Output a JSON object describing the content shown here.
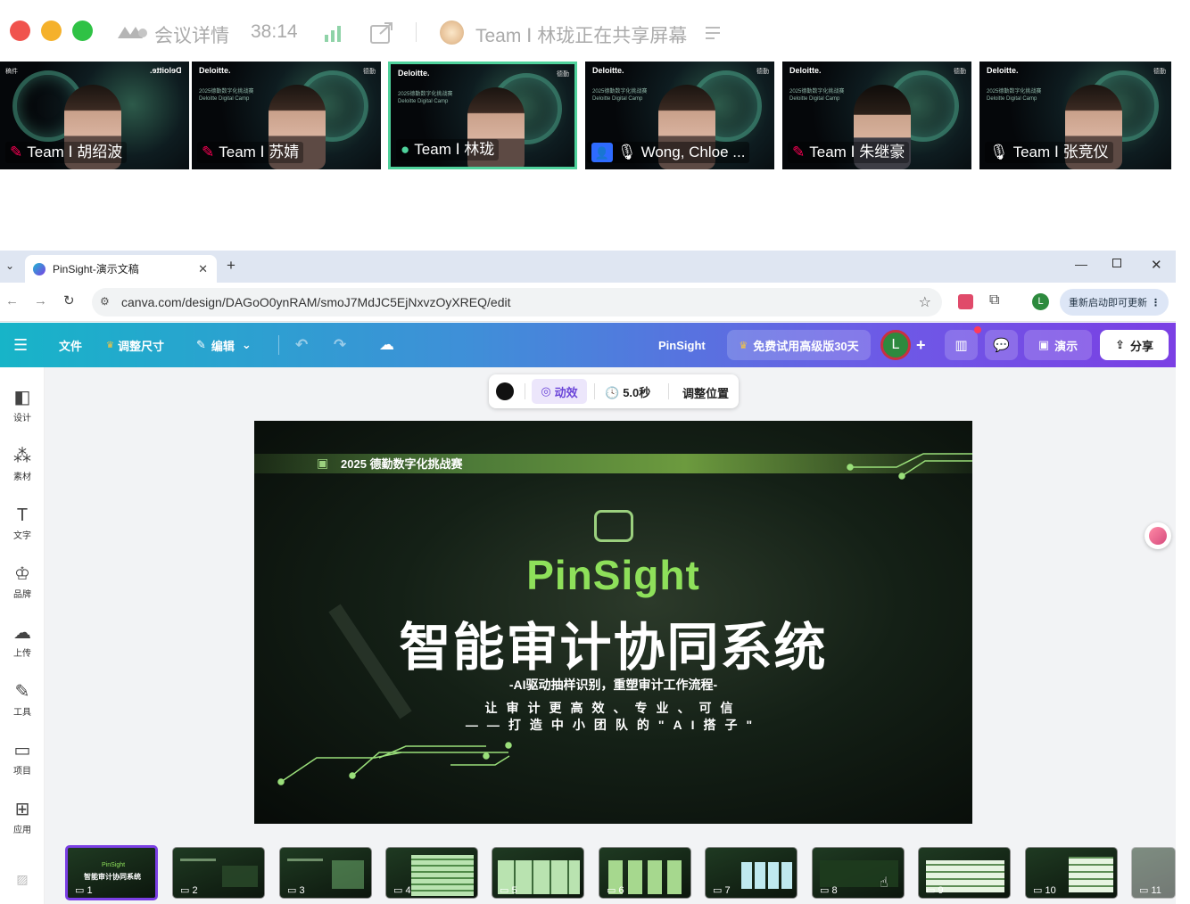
{
  "meeting": {
    "title": "会议详情",
    "timer": "38:14",
    "sharing": "Team Ⅰ 林珑正在共享屏幕"
  },
  "participants": [
    {
      "name": "Team Ⅰ 胡绍波",
      "muted": true,
      "active": false
    },
    {
      "name": "Team Ⅰ 苏婧",
      "muted": true,
      "active": false
    },
    {
      "name": "Team Ⅰ 林珑",
      "muted": false,
      "active": true
    },
    {
      "name": "Wong, Chloe ...",
      "muted": false,
      "active": false
    },
    {
      "name": "Team Ⅰ 朱继豪",
      "muted": true,
      "active": false
    },
    {
      "name": "Team Ⅰ 张竞仪",
      "muted": false,
      "active": false
    }
  ],
  "tile_brand": "Deloitte.",
  "browser": {
    "tab_title": "PinSight-演示文稿",
    "url": "canva.com/design/DAGoO0ynRAM/smoJ7MdJC5EjNxvzOyXREQ/edit",
    "profile_initial": "L",
    "update_label": "重新启动即可更新"
  },
  "canva": {
    "file": "文件",
    "resize": "调整尺寸",
    "edit": "编辑",
    "doc_name": "PinSight",
    "trial": "免费试用高级版30天",
    "avatar": "L",
    "present": "演示",
    "share": "分享"
  },
  "floating_toolbar": {
    "animate": "动效",
    "duration": "5.0秒",
    "position": "调整位置"
  },
  "side_rail": [
    {
      "label": "设计",
      "icon": "design-icon"
    },
    {
      "label": "素材",
      "icon": "elements-icon"
    },
    {
      "label": "文字",
      "icon": "text-icon"
    },
    {
      "label": "品牌",
      "icon": "brand-icon"
    },
    {
      "label": "上传",
      "icon": "upload-icon"
    },
    {
      "label": "工具",
      "icon": "tools-icon"
    },
    {
      "label": "项目",
      "icon": "folder-icon"
    },
    {
      "label": "应用",
      "icon": "apps-icon"
    }
  ],
  "slide": {
    "banner": "2025 德勤数字化挑战赛",
    "title": "PinSight",
    "main": "智能审计协同系统",
    "subtitle": "-AI驱动抽样识别，重塑审计工作流程-",
    "line1": "让审计更高效、专业、可信",
    "line2": "——打造中小团队的\"AI搭子\""
  },
  "thumbnails": [
    {
      "num": "1",
      "title": "智能审计协同系统",
      "brand": "PinSight"
    },
    {
      "num": "2"
    },
    {
      "num": "3"
    },
    {
      "num": "4"
    },
    {
      "num": "5"
    },
    {
      "num": "6"
    },
    {
      "num": "7"
    },
    {
      "num": "8"
    },
    {
      "num": "9"
    },
    {
      "num": "10"
    },
    {
      "num": "11"
    }
  ],
  "colors": {
    "canva_gradient_start": "#17b4c8",
    "canva_gradient_end": "#7b3fe4",
    "slide_accent": "#8ee05a",
    "active_speaker": "#4fd29c"
  }
}
